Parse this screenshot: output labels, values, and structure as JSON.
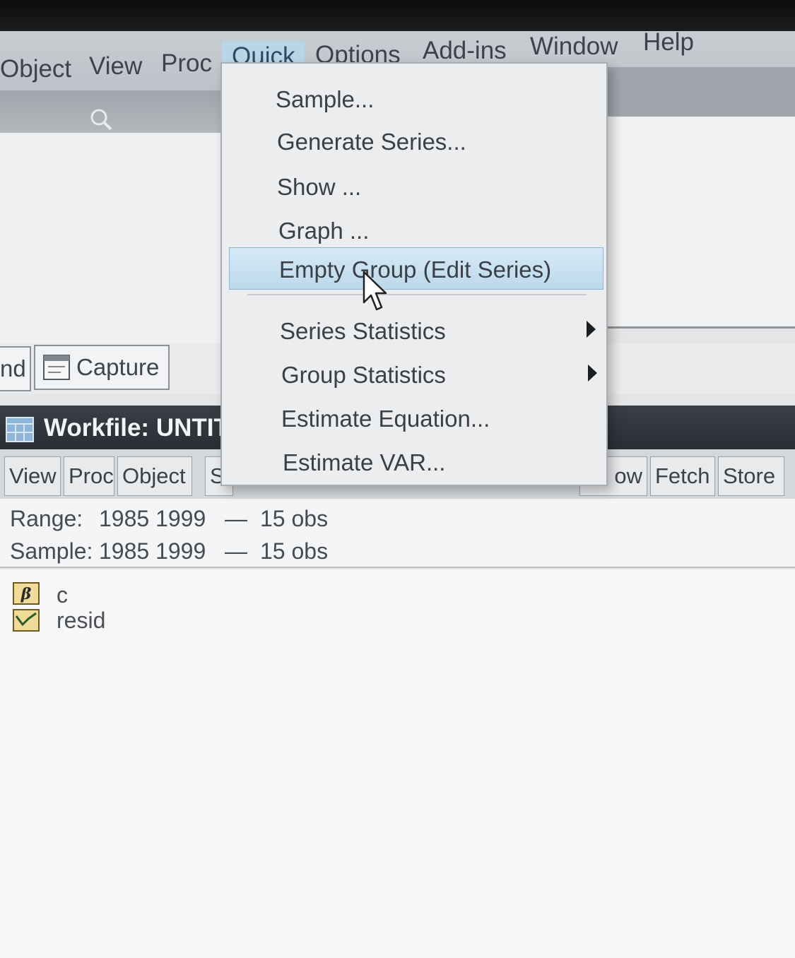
{
  "menubar": {
    "items": [
      "Object",
      "View",
      "Proc",
      "Quick",
      "Options",
      "Add-ins",
      "Window",
      "Help"
    ],
    "active": "Quick"
  },
  "command_buttons": {
    "partial_left": "nd",
    "capture": "Capture"
  },
  "quick_menu": {
    "items": [
      {
        "label": "Sample..."
      },
      {
        "label": "Generate Series..."
      },
      {
        "label": "Show ..."
      },
      {
        "label": "Graph ..."
      },
      {
        "label": "Empty Group (Edit Series)",
        "highlighted": true
      },
      {
        "label": "Series Statistics",
        "submenu": true
      },
      {
        "label": "Group Statistics",
        "submenu": true
      },
      {
        "label": "Estimate Equation..."
      },
      {
        "label": "Estimate VAR..."
      }
    ]
  },
  "workfile": {
    "title": "Workfile: UNTIT",
    "toolbar_left": [
      "View",
      "Proc",
      "Object",
      "S"
    ],
    "toolbar_right": [
      "ow",
      "Fetch",
      "Store"
    ],
    "range_label": "Range:",
    "range_value": "1985 1999",
    "range_dash": "—",
    "range_obs": "15 obs",
    "sample_label": "Sample:",
    "sample_value": "1985 1999",
    "sample_dash": "—",
    "sample_obs": "15 obs",
    "objects": [
      {
        "name": "c",
        "icon": "coefficient-icon"
      },
      {
        "name": "resid",
        "icon": "series-icon"
      }
    ]
  },
  "colors": {
    "menu_active": "#b8d6e8",
    "highlight": "#bcd9ec",
    "title_bar": "#2a2e33"
  }
}
